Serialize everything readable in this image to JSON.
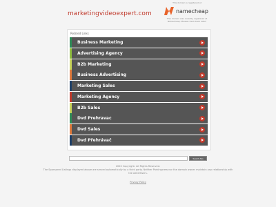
{
  "header": {
    "domain": "marketingvideoexpert.com",
    "registered_note": "This domain is registered at",
    "brand": "namecheap",
    "brand_note": "This domain was recently registered at Namecheap. Please check back later!"
  },
  "panel": {
    "title": "Related Links",
    "links": [
      {
        "label": "Business Marketing",
        "color": "#2e8b57"
      },
      {
        "label": "Advertising Agency",
        "color": "#8fbc3f"
      },
      {
        "label": "B2b Marketing",
        "color": "#c8d45a"
      },
      {
        "label": "Business Advertising",
        "color": "#e07a3c"
      },
      {
        "label": "Marketing Sales",
        "color": "#1e3f66"
      },
      {
        "label": "Marketing Agency",
        "color": "#c0392b"
      },
      {
        "label": "B2b Sales",
        "color": "#c8d45a"
      },
      {
        "label": "Dvd Prehravac",
        "color": "#2e8b57"
      },
      {
        "label": "Dvd Sales",
        "color": "#e07a3c"
      },
      {
        "label": "Dvd Přehrávač",
        "color": "#1e3f66"
      }
    ]
  },
  "search": {
    "placeholder": "",
    "button_label": "Search Ads"
  },
  "footer": {
    "copyright": "2020 Copyright. All Rights Reserved.",
    "disclaimer": "The Sponsored Listings displayed above are served automatically by a third party. Neither Parkingcrew nor the domain owner maintain any relationship with the advertisers.",
    "privacy": "Privacy Policy"
  },
  "colors": {
    "accent": "#c0392b",
    "row_bg": "#555555"
  }
}
